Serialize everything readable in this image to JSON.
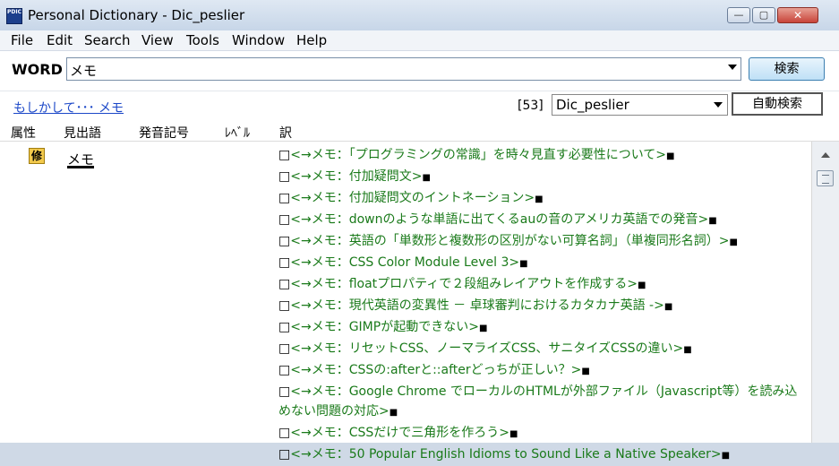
{
  "window": {
    "title": "Personal Dictionary - Dic_peslier",
    "app_icon": "PDIC",
    "close_glyph": "✕",
    "max_glyph": "▢",
    "min_glyph": "—"
  },
  "menu": [
    "File",
    "Edit",
    "Search",
    "View",
    "Tools",
    "Window",
    "Help"
  ],
  "word": {
    "label": "WORD",
    "value": "メモ",
    "search_button": "検索"
  },
  "suggest": {
    "maybe_link": "もしかして･･･ メモ",
    "count": "[53]",
    "dictionary": "Dic_peslier",
    "auto_search": "自動検索"
  },
  "columns": [
    "属性",
    "見出語",
    "発音記号",
    "ﾚﾍﾞﾙ",
    "訳"
  ],
  "entry": {
    "attr_badge": "修",
    "headword": "メモ",
    "definitions": [
      "<→メモ：「プログラミングの常識」を時々見直す必要性について>",
      "<→メモ：付加疑問文>",
      "<→メモ：付加疑問文のイントネーション>",
      "<→メモ：downのような単語に出てくるauの音のアメリカ英語での発音>",
      "<→メモ：英語の「単数形と複数形の区別がない可算名詞」（単複同形名詞）>",
      "<→メモ：CSS Color Module Level 3>",
      "<→メモ：floatプロパティで２段組みレイアウトを作成する>",
      "<→メモ：現代英語の変異性 － 卓球審判におけるカタカナ英語 ->",
      "<→メモ：GIMPが起動できない>",
      "<→メモ：リセットCSS、ノーマライズCSS、サニタイズCSSの違い>",
      "<→メモ：CSSの:afterと::afterどっちが正しい？>",
      "<→メモ：Google Chrome でローカルのHTMLが外部ファイル（Javascript等）を読み込めない問題の対応>",
      "<→メモ：CSSだけで三角形を作ろう>",
      "<→メモ：50 Popular English Idioms to Sound Like a Native Speaker>"
    ],
    "checkbox_glyph": "□",
    "end_glyph": "■"
  }
}
